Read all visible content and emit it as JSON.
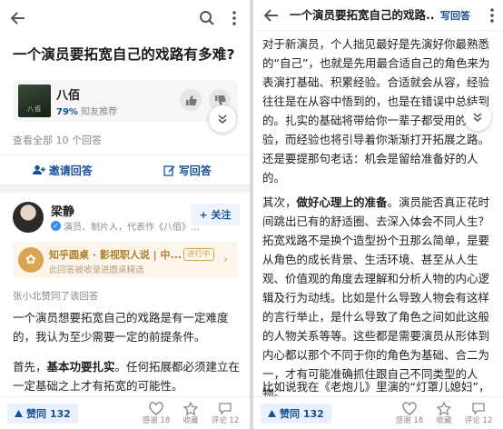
{
  "left": {
    "question_title": "一个演员要拓宽自己的戏路有多难?",
    "topic": {
      "name": "八佰",
      "percent": "79%",
      "recommend_label": "知友推荐",
      "poster_text": "八佰"
    },
    "view_all": "查看全部 10 个回答",
    "invite_label": "邀请回答",
    "write_label": "写回答",
    "author": {
      "name": "梁静",
      "desc": "演员、制片人，代表作《八佰》...",
      "follow_label": "+ 关注"
    },
    "circle": {
      "title": "知乎圆桌 · 影视职人说 | 中...",
      "subtitle": "此回答被收录进圆桌精选",
      "tag": "进行中"
    },
    "voted_text": "张小北赞同了该回答",
    "paragraphs": [
      "一个演员想要拓宽自己的戏路是有一定难度的，我认为至少需要一定的前提条件。",
      [
        "首先，",
        "基本功要扎实",
        "。任何拓展都必须建立在一定基础之上才有拓宽的可能性。"
      ]
    ],
    "bottom": {
      "vote_label": "赞同 132",
      "thanks": "感谢 18",
      "collect": "收藏",
      "comment": "评论 12"
    }
  },
  "right": {
    "title": "一个演员要拓宽自己的戏路...",
    "write_label": "写回答",
    "paragraphs": [
      "对于新演员，个人拙见最好是先演好你最熟悉的“自己”，也就是先用最合适自己的角色来为表演打基础、积累经验。合适就会从容，经验往往是在从容中悟到的，也是在错误中总结到的。扎实的基础将带给你一辈子都受用的经验，而经验也将引导着你渐渐打开拓展之路。还是要提那句老话：机会是留给准备好的人的。",
      [
        "其次，",
        "做好心理上的准备",
        "。演员能否真正花时间跳出已有的舒适圈、去深入体会不同人生？拓宽戏路不是换个造型扮个丑那么简单，是要从角色的成长背景、生活环境、甚至从人生观、价值观的角度去理解和分析人物的内心逻辑及行为动线。比如是什么导致人物会有这样的言行举止，是什么导致了角色之间如此这般的人物关系等等。这些都是需要演员从形体到内心都以那个不同于你的角色为基础、合二为一，才有可能准确抓住跟自己不同类型的人物。"
      ],
      "比如说我在《老炮儿》里演的“灯罩儿媳妇”，"
    ],
    "bottom": {
      "vote_label": "赞同 132",
      "thanks": "感谢 18",
      "collect": "收藏",
      "comment": "评论 12"
    }
  }
}
